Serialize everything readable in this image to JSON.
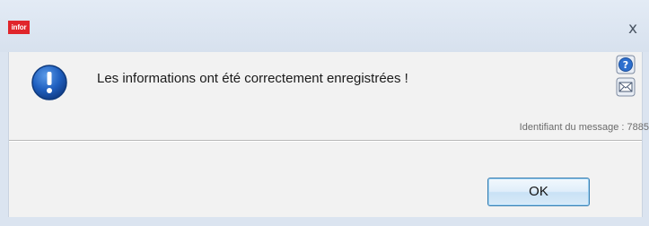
{
  "window": {
    "logo_text": "infor",
    "close_symbol": "x"
  },
  "dialog": {
    "icon": "information-icon",
    "message": "Les informations ont été correctement enregistrées !",
    "help_icon": "help-icon",
    "mail_icon": "mail-icon",
    "message_id_text": "Identifiant du message : 7885"
  },
  "buttons": {
    "ok_label": "OK"
  },
  "colors": {
    "brand_red": "#e0252b",
    "info_blue": "#1f5fbf",
    "button_border": "#3c7fb1"
  }
}
